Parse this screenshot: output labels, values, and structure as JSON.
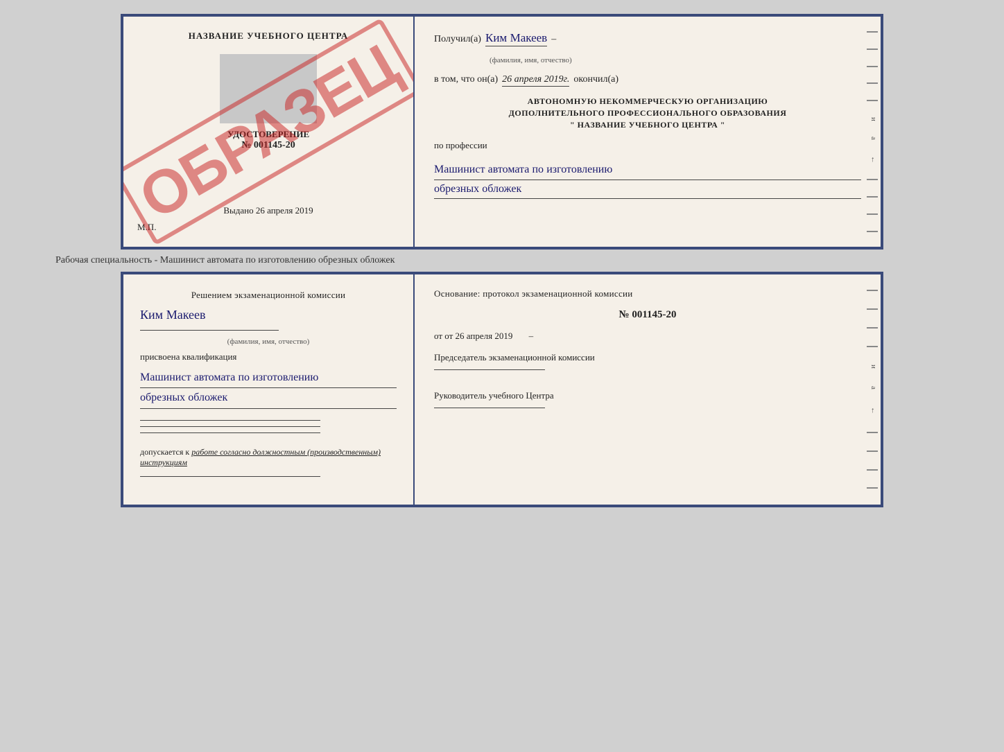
{
  "topCert": {
    "left": {
      "title": "НАЗВАНИЕ УЧЕБНОГО ЦЕНТРА",
      "stamp": "ОБРАЗЕЦ",
      "udostLabel": "УДОСТОВЕРЕНИЕ",
      "number": "№ 001145-20",
      "vydano": "Выдано 26 апреля 2019",
      "mp": "М.П."
    },
    "right": {
      "poluchilLabel": "Получил(а)",
      "name": "Ким Макеев",
      "nameSub": "(фамилия, имя, отчество)",
      "vtomLabel": "в том, что он(a)",
      "date": "26 апреля 2019г.",
      "okonchilLabel": "окончил(а)",
      "org1": "АВТОНОМНУЮ НЕКОММЕРЧЕСКУЮ ОРГАНИЗАЦИЮ",
      "org2": "ДОПОЛНИТЕЛЬНОГО ПРОФЕССИОНАЛЬНОГО ОБРАЗОВАНИЯ",
      "org3": "\"   НАЗВАНИЕ УЧЕБНОГО ЦЕНТРА   \"",
      "profLabel": "по профессии",
      "prof1": "Машинист автомата по изготовлению",
      "prof2": "обрезных обложек"
    }
  },
  "separatorText": "Рабочая специальность - Машинист автомата по изготовлению обрезных обложек",
  "bottomCert": {
    "left": {
      "reshenieLabel": "Решением экзаменационной комиссии",
      "name": "Ким Макеев",
      "nameSub": "(фамилия, имя, отчество)",
      "kvaliLabel": "присвоена квалификация",
      "prof1": "Машинист автомата по изготовлению",
      "prof2": "обрезных обложек",
      "dopuskLabel": "допускается к",
      "dopuskText": "работе согласно должностным (производственным) инструкциям"
    },
    "right": {
      "osnovLabel": "Основание: протокол экзаменационной комиссии",
      "number": "№  001145-20",
      "dateLabel": "от 26 апреля 2019",
      "predsedLabel": "Председатель экзаменационной комиссии",
      "rukovLabel": "Руководитель учебного Центра"
    }
  }
}
